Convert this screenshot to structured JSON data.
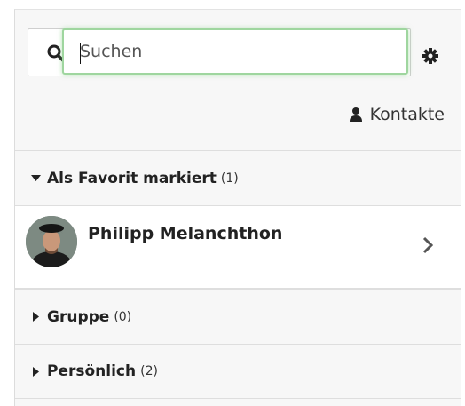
{
  "search": {
    "placeholder": "Suchen"
  },
  "contacts_link": {
    "label": "Kontakte"
  },
  "favorites": {
    "label": "Als Favorit markiert",
    "count": "(1)"
  },
  "contact": {
    "name": "Philipp Melanchthon"
  },
  "groups": [
    {
      "label": "Gruppe",
      "count": "(0)"
    },
    {
      "label": "Persönlich",
      "count": "(2)"
    }
  ],
  "colors": {
    "focus_ring": "#9fd69f",
    "panel_bg": "#f7f7f7"
  },
  "icons": [
    "search-icon",
    "gear-icon",
    "user-icon",
    "caret-down-icon",
    "chevron-right-icon",
    "caret-right-icon"
  ]
}
